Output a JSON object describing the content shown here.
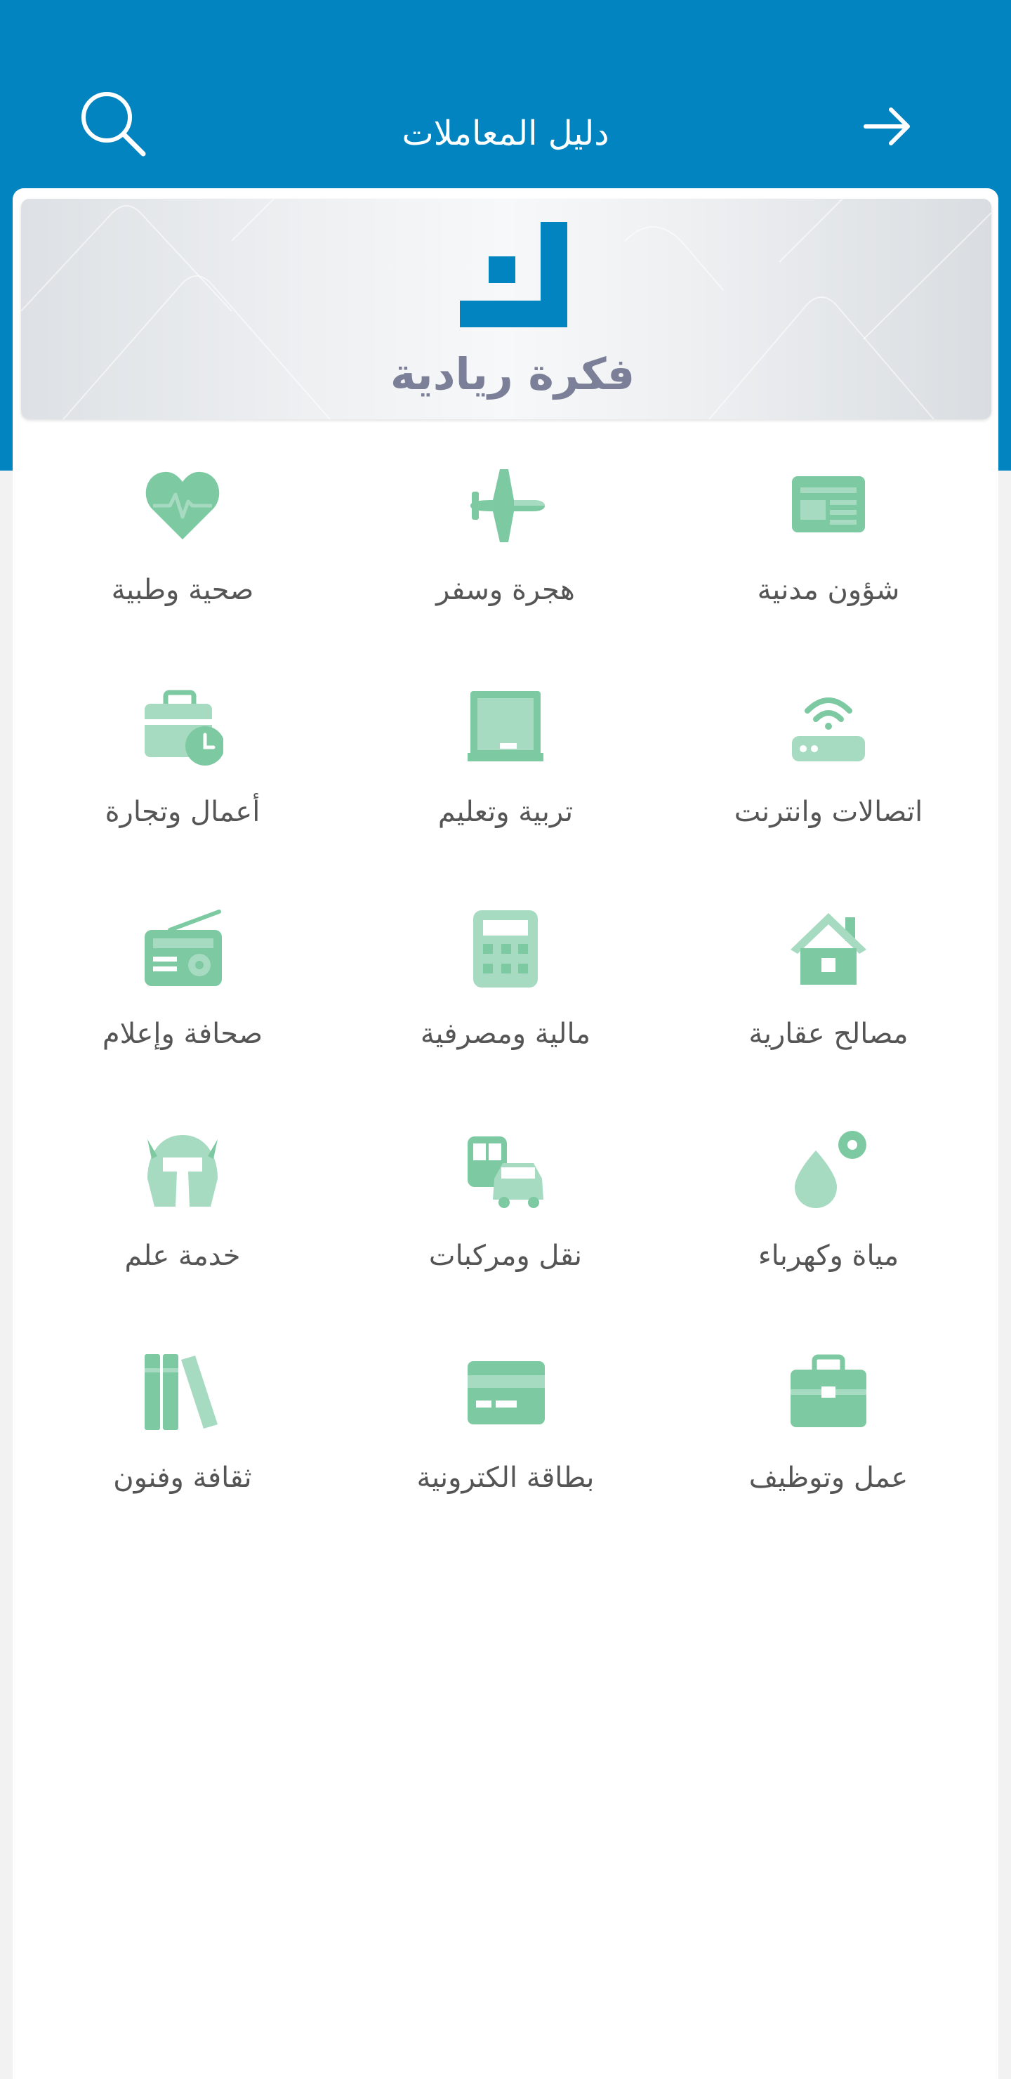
{
  "header": {
    "title": "دليل المعاملات",
    "search_icon": "search-icon",
    "back_icon": "arrow-right-icon"
  },
  "banner": {
    "brand_name": "فكرة ريادية",
    "logo_icon": "brand-logo"
  },
  "colors": {
    "header_bg": "#0284c1",
    "icon_green": "#7dc9a2",
    "icon_green_light": "#a6dbc1",
    "label_text": "#555555",
    "brand_text": "#7c7f98",
    "logo_blue": "#0284c1"
  },
  "categories": [
    {
      "label": "شؤون مدنية",
      "icon": "id-card-icon"
    },
    {
      "label": "هجرة وسفر",
      "icon": "airplane-icon"
    },
    {
      "label": "صحية وطبية",
      "icon": "heartbeat-icon"
    },
    {
      "label": "اتصالات وانترنت",
      "icon": "wifi-router-icon"
    },
    {
      "label": "تربية وتعليم",
      "icon": "blackboard-icon"
    },
    {
      "label": "أعمال وتجارة",
      "icon": "briefcase-clock-icon"
    },
    {
      "label": "مصالح عقارية",
      "icon": "house-icon"
    },
    {
      "label": "مالية ومصرفية",
      "icon": "calculator-icon"
    },
    {
      "label": "صحافة وإعلام",
      "icon": "radio-icon"
    },
    {
      "label": "مياة وكهرباء",
      "icon": "water-drop-icon"
    },
    {
      "label": "نقل ومركبات",
      "icon": "bus-car-icon"
    },
    {
      "label": "خدمة علم",
      "icon": "helmet-icon"
    },
    {
      "label": "عمل وتوظيف",
      "icon": "briefcase-icon"
    },
    {
      "label": "بطاقة الكترونية",
      "icon": "credit-card-icon"
    },
    {
      "label": "ثقافة وفنون",
      "icon": "books-icon"
    }
  ]
}
